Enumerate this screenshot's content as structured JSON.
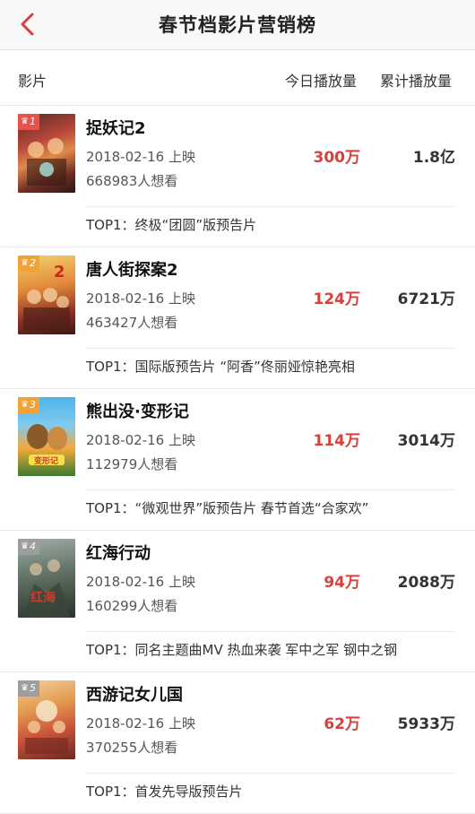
{
  "header": {
    "title": "春节档影片营销榜",
    "back_icon": "chevron-left-icon"
  },
  "columns": {
    "film": "影片",
    "today": "今日播放量",
    "total": "累计播放量"
  },
  "colors": {
    "accent": "#d9403a",
    "rank_1": "#e5534b",
    "rank_2": "#f0a336",
    "rank_3": "#f0a336",
    "rank_4": "#9e9e9e",
    "rank_5": "#9e9e9e"
  },
  "movies": [
    {
      "rank": "1",
      "name": "捉妖记2",
      "date": "2018-02-16 上映",
      "want": "668983人想看",
      "today": "300万",
      "total": "1.8亿",
      "trailer": "TOP1：终极“团圆”版预告片"
    },
    {
      "rank": "2",
      "name": "唐人街探案2",
      "date": "2018-02-16 上映",
      "want": "463427人想看",
      "today": "124万",
      "total": "6721万",
      "trailer": "TOP1：国际版预告片 “阿香”佟丽娅惊艳亮相"
    },
    {
      "rank": "3",
      "name": "熊出没·变形记",
      "date": "2018-02-16 上映",
      "want": "112979人想看",
      "today": "114万",
      "total": "3014万",
      "trailer": "TOP1：“微观世界”版预告片 春节首选“合家欢”"
    },
    {
      "rank": "4",
      "name": "红海行动",
      "date": "2018-02-16 上映",
      "want": "160299人想看",
      "today": "94万",
      "total": "2088万",
      "trailer": "TOP1：同名主题曲MV 热血来袭 军中之军 钢中之钢"
    },
    {
      "rank": "5",
      "name": "西游记女儿国",
      "date": "2018-02-16 上映",
      "want": "370255人想看",
      "today": "62万",
      "total": "5933万",
      "trailer": "TOP1：首发先导版预告片"
    }
  ]
}
